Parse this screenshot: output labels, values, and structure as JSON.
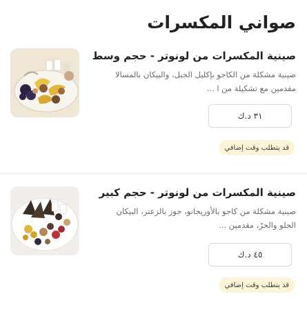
{
  "section": {
    "title": "صواني المكسرات"
  },
  "items": [
    {
      "title": "صينية المكسرات من لونوتر - حجم وسط",
      "description": "صينية مشكلة من الكاجو بإكليل الجبل، والبيكان بالمسالا مقدمين مع تشكيلة من ا ...",
      "price": "٣١ د.ك",
      "badge": "قد يتطلب وقت إضافي"
    },
    {
      "title": "صينية المكسرات من لونوتر - حجم كبير",
      "description": "صينية مشكلة من كاجو بالأوريجانو، جوز بالزعتر، البيكان الحلو والحرّ، مقدمين ...",
      "price": "٤٥ د.ك",
      "badge": "قد يتطلب وقت إضافي"
    }
  ],
  "colors": {
    "badge_bg": "#fdf3d6",
    "divider": "#e6e6e6"
  },
  "icons": [
    "nut-tray-medium-image",
    "nut-tray-large-image"
  ]
}
